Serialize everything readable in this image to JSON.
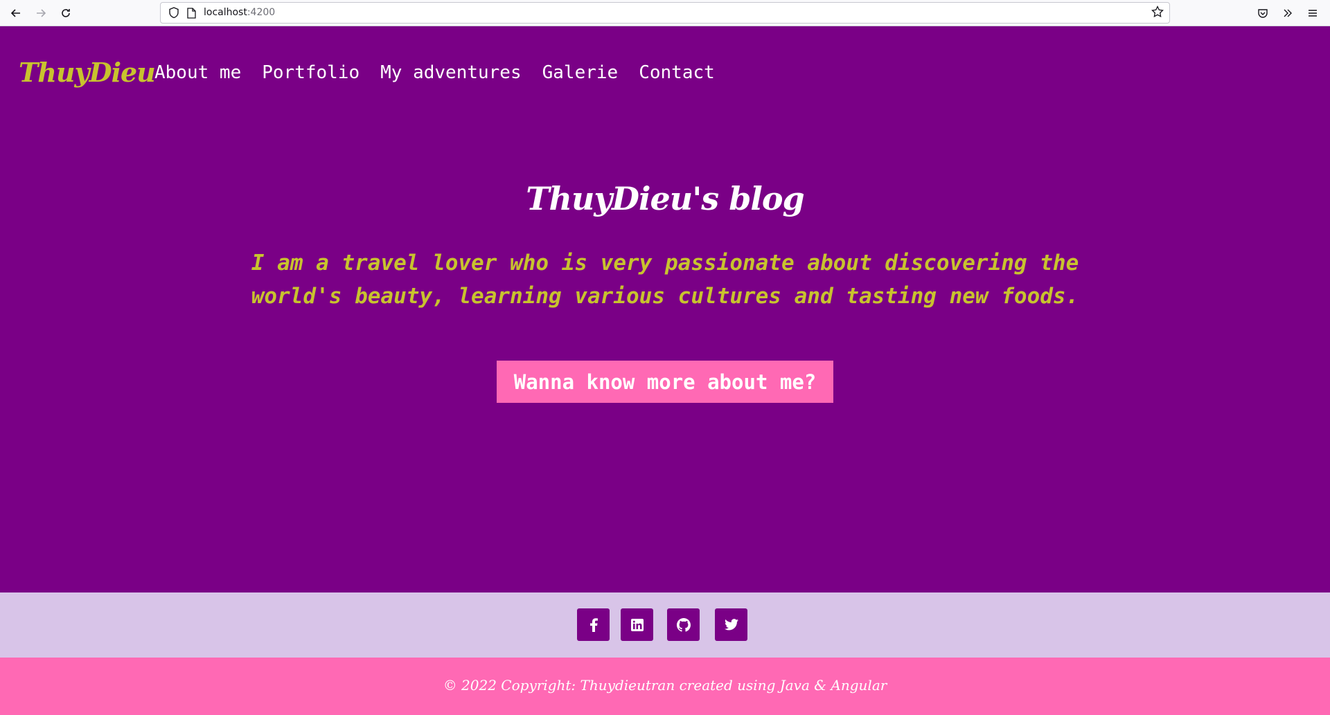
{
  "browser": {
    "url_host": "localhost",
    "url_port": ":4200",
    "back_icon": "arrow-left",
    "forward_icon": "arrow-right",
    "reload_icon": "reload",
    "bookmark_icon": "star"
  },
  "site": {
    "brand": "ThuyDieu",
    "nav": {
      "about": "About me",
      "portfolio": "Portfolio",
      "adventures": "My adventures",
      "galerie": "Galerie",
      "contact": "Contact"
    },
    "hero": {
      "title": "ThuyDieu's blog",
      "tagline": "I am a travel lover who is very passionate about discovering the world's beauty, learning various cultures and tasting new foods.",
      "cta": "Wanna know more about me?"
    },
    "social": [
      "facebook-icon",
      "linkedin-icon",
      "github-icon",
      "twitter-icon"
    ],
    "footer": {
      "copyright": "© 2022 Copyright: Thuydieutran created using Java & Angular"
    }
  },
  "colors": {
    "hero_bg": "#7a0086",
    "accent_yellow": "#c8c32e",
    "pink": "#ff69b4",
    "lavender": "#d8c4e8"
  }
}
